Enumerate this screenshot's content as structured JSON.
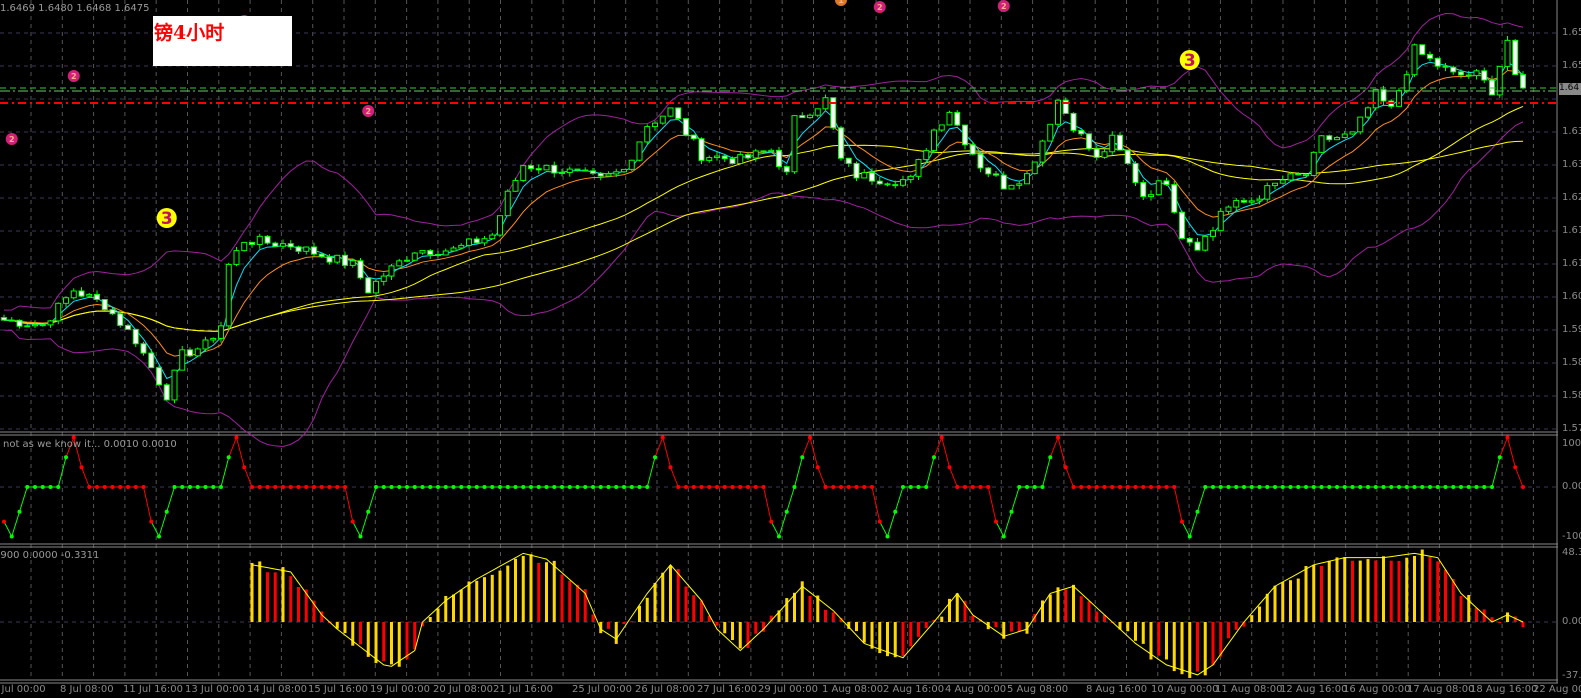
{
  "header": {
    "ohlc_text": "1.6469 1.6480 1.6468 1.6475",
    "title": "镑4小时"
  },
  "indicators": {
    "osc1_label": "not as we know it...  0.0010 0.0010",
    "osc2_label": "2900 0.0000 -0.3311"
  },
  "axes": {
    "price_labels": [
      "1.65",
      "1.65",
      "1.64",
      "1.63",
      "1.63",
      "1.62",
      "1.61",
      "1.61",
      "1.60",
      "1.59",
      "1.58",
      "1.58",
      "1.57"
    ],
    "current_price_label": "1.64",
    "osc1_labels": [
      "100",
      "0.00",
      "-100"
    ],
    "osc2_labels": [
      "48.3",
      "0.00",
      "-37.5"
    ],
    "time_labels": [
      "5 Jul 00:00",
      "8 Jul 08:00",
      "11 Jul 16:00",
      "13 Jul 00:00",
      "14 Jul 08:00",
      "15 Jul 16:00",
      "19 Jul 00:00",
      "20 Jul 08:00",
      "21 Jul 16:00",
      "25 Jul 00:00",
      "26 Jul 08:00",
      "27 Jul 16:00",
      "29 Jul 00:00",
      "1 Aug 08:00",
      "2 Aug 16:00",
      "4 Aug 00:00",
      "5 Aug 08:00",
      "8 Aug 16:00",
      "10 Aug 00:00",
      "11 Aug 08:00",
      "12 Aug 16:00",
      "16 Aug 00:00",
      "17 Aug 08:00",
      "18 Aug 16:00",
      "22 Aug 00:00"
    ]
  },
  "colors": {
    "bull": "#00ff00",
    "bear": "#ffffff",
    "ema_fast": "#00e5ff",
    "ema_mid": "#ff8c1a",
    "ma_slow": "#ffff00",
    "bands": "#a020a0",
    "up": "#00ff00",
    "down": "#ff0000",
    "hist_up": "#ffd700",
    "hist_down": "#ff0000",
    "signal": "#ffff00"
  },
  "chart_data": [
    {
      "type": "candlestick",
      "title": "GBP 4H",
      "bars": 197,
      "close_path": [
        [
          0,
          1.6011
        ],
        [
          5,
          1.6001
        ],
        [
          9,
          1.6071
        ],
        [
          13,
          1.6041
        ],
        [
          17,
          1.5971
        ],
        [
          21,
          1.5861
        ],
        [
          23,
          1.5941
        ],
        [
          26,
          1.5961
        ],
        [
          28,
          1.6001
        ],
        [
          29,
          1.6121
        ],
        [
          31,
          1.6171
        ],
        [
          37,
          1.6161
        ],
        [
          41,
          1.6141
        ],
        [
          45,
          1.6121
        ],
        [
          47,
          1.6071
        ],
        [
          49,
          1.6101
        ],
        [
          53,
          1.6151
        ],
        [
          58,
          1.6151
        ],
        [
          63,
          1.6181
        ],
        [
          65,
          1.6261
        ],
        [
          67,
          1.6321
        ],
        [
          72,
          1.6311
        ],
        [
          77,
          1.6291
        ],
        [
          80,
          1.6311
        ],
        [
          83,
          1.6401
        ],
        [
          86,
          1.6431
        ],
        [
          90,
          1.6341
        ],
        [
          95,
          1.6331
        ],
        [
          99,
          1.6351
        ],
        [
          101,
          1.6301
        ],
        [
          102,
          1.6411
        ],
        [
          105,
          1.6441
        ],
        [
          106,
          1.6451
        ],
        [
          108,
          1.6331
        ],
        [
          110,
          1.6301
        ],
        [
          114,
          1.6291
        ],
        [
          117,
          1.6291
        ],
        [
          120,
          1.6391
        ],
        [
          122,
          1.6431
        ],
        [
          124,
          1.6371
        ],
        [
          126,
          1.6321
        ],
        [
          129,
          1.6281
        ],
        [
          132,
          1.6301
        ],
        [
          134,
          1.6371
        ],
        [
          136,
          1.6451
        ],
        [
          138,
          1.6401
        ],
        [
          141,
          1.6331
        ],
        [
          143,
          1.6371
        ],
        [
          145,
          1.6321
        ],
        [
          147,
          1.6261
        ],
        [
          150,
          1.6291
        ],
        [
          152,
          1.6181
        ],
        [
          154,
          1.6161
        ],
        [
          156,
          1.6191
        ],
        [
          157,
          1.6231
        ],
        [
          161,
          1.6251
        ],
        [
          165,
          1.6291
        ],
        [
          168,
          1.6301
        ],
        [
          170,
          1.6371
        ],
        [
          174,
          1.6381
        ],
        [
          177,
          1.6461
        ],
        [
          179,
          1.6431
        ],
        [
          182,
          1.6551
        ],
        [
          185,
          1.6521
        ],
        [
          187,
          1.6501
        ],
        [
          190,
          1.6501
        ],
        [
          192,
          1.6471
        ],
        [
          194,
          1.6571
        ],
        [
          195,
          1.6491
        ],
        [
          196,
          1.6475
        ]
      ],
      "levels": [
        {
          "price": 1.6475,
          "style": "green-dash"
        },
        {
          "price": 1.6469,
          "style": "green-dashdot"
        },
        {
          "price": 1.6445,
          "style": "red-dashdot"
        }
      ],
      "markers": [
        {
          "bar": 1,
          "price": 1.6373,
          "label": "2",
          "kind": "pink"
        },
        {
          "bar": 9,
          "price": 1.6499,
          "label": "2",
          "kind": "pink"
        },
        {
          "bar": 31,
          "price": 1.6609,
          "label": "2",
          "kind": "pink"
        },
        {
          "bar": 47,
          "price": 1.6429,
          "label": "2",
          "kind": "pink"
        },
        {
          "bar": 86,
          "price": 1.6841,
          "label": "2",
          "kind": "pink"
        },
        {
          "bar": 100,
          "price": 1.6669,
          "label": "2",
          "kind": "pink"
        },
        {
          "bar": 113,
          "price": 1.6637,
          "label": "2",
          "kind": "pink"
        },
        {
          "bar": 122,
          "price": 1.6839,
          "label": "2",
          "kind": "pink"
        },
        {
          "bar": 129,
          "price": 1.6639,
          "label": "2",
          "kind": "pink"
        },
        {
          "bar": 137,
          "price": 1.6873,
          "label": "2",
          "kind": "pink"
        },
        {
          "bar": 53,
          "price": 1.6747,
          "label": "1",
          "kind": "orange"
        },
        {
          "bar": 57,
          "price": 1.6697,
          "label": "1",
          "kind": "orange"
        },
        {
          "bar": 66,
          "price": 1.6747,
          "label": "1",
          "kind": "orange"
        },
        {
          "bar": 71,
          "price": 1.6675,
          "label": "1",
          "kind": "orange"
        },
        {
          "bar": 73,
          "price": 1.6737,
          "label": "1",
          "kind": "orange"
        },
        {
          "bar": 95,
          "price": 1.6703,
          "label": "1",
          "kind": "orange"
        },
        {
          "bar": 97,
          "price": 1.6787,
          "label": "1",
          "kind": "orange"
        },
        {
          "bar": 108,
          "price": 1.6651,
          "label": "1",
          "kind": "orange"
        },
        {
          "bar": 113,
          "price": 1.6735,
          "label": "1",
          "kind": "orange"
        },
        {
          "bar": 170,
          "price": 1.6811,
          "label": "1",
          "kind": "orange"
        },
        {
          "bar": 174,
          "price": 1.6727,
          "label": "1",
          "kind": "orange"
        },
        {
          "bar": 176,
          "price": 1.6873,
          "label": "1",
          "kind": "orange"
        },
        {
          "bar": 180,
          "price": 1.6755,
          "label": "1",
          "kind": "orange"
        },
        {
          "bar": 182,
          "price": 1.6985,
          "label": "1",
          "kind": "orange"
        },
        {
          "bar": 188,
          "price": 1.6821,
          "label": "1",
          "kind": "orange"
        },
        {
          "bar": 21,
          "price": 1.6215,
          "label": "3",
          "kind": "yellow"
        },
        {
          "bar": 104,
          "price": 1.6875,
          "label": "3",
          "kind": "yellow"
        },
        {
          "bar": 153,
          "price": 1.6531,
          "label": "3",
          "kind": "yellow"
        },
        {
          "bar": 194,
          "price": 1.7011,
          "label": "3",
          "kind": "yellow"
        }
      ]
    },
    {
      "type": "line",
      "title": "not as we know it...",
      "ylim": [
        -100,
        100
      ],
      "peak_pattern": [
        60,
        100,
        40,
        0
      ],
      "trough_pattern": [
        -70,
        -100,
        -50,
        0
      ],
      "events": [
        {
          "bar": 1,
          "type": "trough"
        },
        {
          "bar": 9,
          "type": "peak"
        },
        {
          "bar": 20,
          "type": "trough"
        },
        {
          "bar": 30,
          "type": "peak"
        },
        {
          "bar": 46,
          "type": "trough"
        },
        {
          "bar": 85,
          "type": "peak"
        },
        {
          "bar": 100,
          "type": "trough"
        },
        {
          "bar": 104,
          "type": "peak"
        },
        {
          "bar": 114,
          "type": "trough"
        },
        {
          "bar": 121,
          "type": "peak"
        },
        {
          "bar": 129,
          "type": "trough"
        },
        {
          "bar": 136,
          "type": "peak"
        },
        {
          "bar": 153,
          "type": "trough"
        },
        {
          "bar": 194,
          "type": "peak"
        }
      ]
    },
    {
      "type": "bar",
      "title": "histogram oscillator",
      "ylim": [
        -37.5,
        48.3
      ],
      "start_bar": 32,
      "signal_path": [
        [
          32,
          40
        ],
        [
          37,
          35
        ],
        [
          41,
          5
        ],
        [
          43,
          -5
        ],
        [
          49,
          -30
        ],
        [
          50,
          -31
        ],
        [
          53,
          -20
        ],
        [
          54,
          0
        ],
        [
          57,
          15
        ],
        [
          61,
          30
        ],
        [
          67,
          48
        ],
        [
          70,
          44
        ],
        [
          75,
          20
        ],
        [
          77,
          -5
        ],
        [
          79,
          -12
        ],
        [
          83,
          20
        ],
        [
          86,
          40
        ],
        [
          90,
          15
        ],
        [
          92,
          -5
        ],
        [
          95,
          -20
        ],
        [
          98,
          -5
        ],
        [
          103,
          25
        ],
        [
          107,
          8
        ],
        [
          111,
          -15
        ],
        [
          116,
          -25
        ],
        [
          120,
          0
        ],
        [
          123,
          20
        ],
        [
          125,
          5
        ],
        [
          129,
          -10
        ],
        [
          132,
          -5
        ],
        [
          135,
          20
        ],
        [
          138,
          25
        ],
        [
          142,
          5
        ],
        [
          146,
          -15
        ],
        [
          150,
          -30
        ],
        [
          154,
          -37
        ],
        [
          156,
          -30
        ],
        [
          160,
          0
        ],
        [
          164,
          25
        ],
        [
          169,
          40
        ],
        [
          173,
          45
        ],
        [
          178,
          45
        ],
        [
          182,
          48
        ],
        [
          185,
          45
        ],
        [
          188,
          20
        ],
        [
          192,
          0
        ],
        [
          194,
          5
        ],
        [
          196,
          0
        ]
      ]
    }
  ]
}
